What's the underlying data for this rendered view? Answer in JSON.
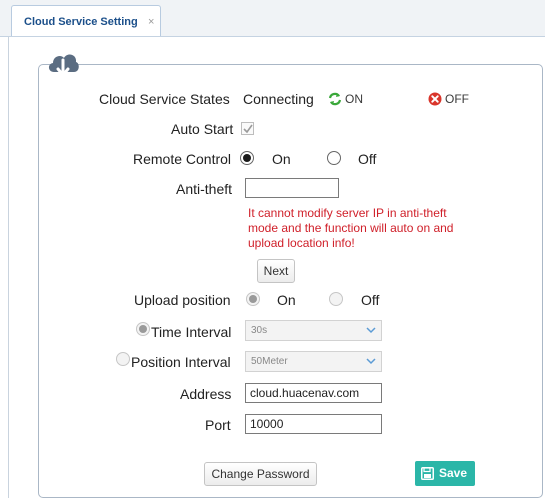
{
  "tab": {
    "title": "Cloud Service Setting",
    "close_glyph": "×"
  },
  "colors": {
    "on_green": "#3aa83a",
    "off_red": "#d9352b",
    "warning_red": "#d0202a",
    "save_teal": "#2bb6a8",
    "tab_text": "#1b4f8a"
  },
  "icons": {
    "header": "cloud-download-icon",
    "on": "sync-green-icon",
    "off": "close-red-icon",
    "save": "floppy-disk-icon",
    "chevron": "chevron-down-icon"
  },
  "form": {
    "cloud_state": {
      "label": "Cloud Service States",
      "value": "Connecting",
      "on_label": "ON",
      "off_label": "OFF"
    },
    "auto_start": {
      "label": "Auto Start",
      "checked": true
    },
    "remote_control": {
      "label": "Remote Control",
      "on_label": "On",
      "off_label": "Off",
      "selected": "On"
    },
    "anti_theft": {
      "label": "Anti-theft",
      "value": ""
    },
    "warning": "It cannot modify server IP in anti-theft mode and the function will auto on and upload location info!",
    "next_label": "Next",
    "upload_position": {
      "label": "Upload position",
      "on_label": "On",
      "off_label": "Off",
      "selected": "On"
    },
    "time_interval": {
      "label": "Time Interval",
      "value": "30s",
      "selected": true
    },
    "position_interval": {
      "label": "Position Interval",
      "value": "50Meter",
      "selected": false
    },
    "address": {
      "label": "Address",
      "value": "cloud.huacenav.com"
    },
    "port": {
      "label": "Port",
      "value": "10000"
    },
    "change_password_label": "Change Password",
    "save_label": "Save"
  }
}
